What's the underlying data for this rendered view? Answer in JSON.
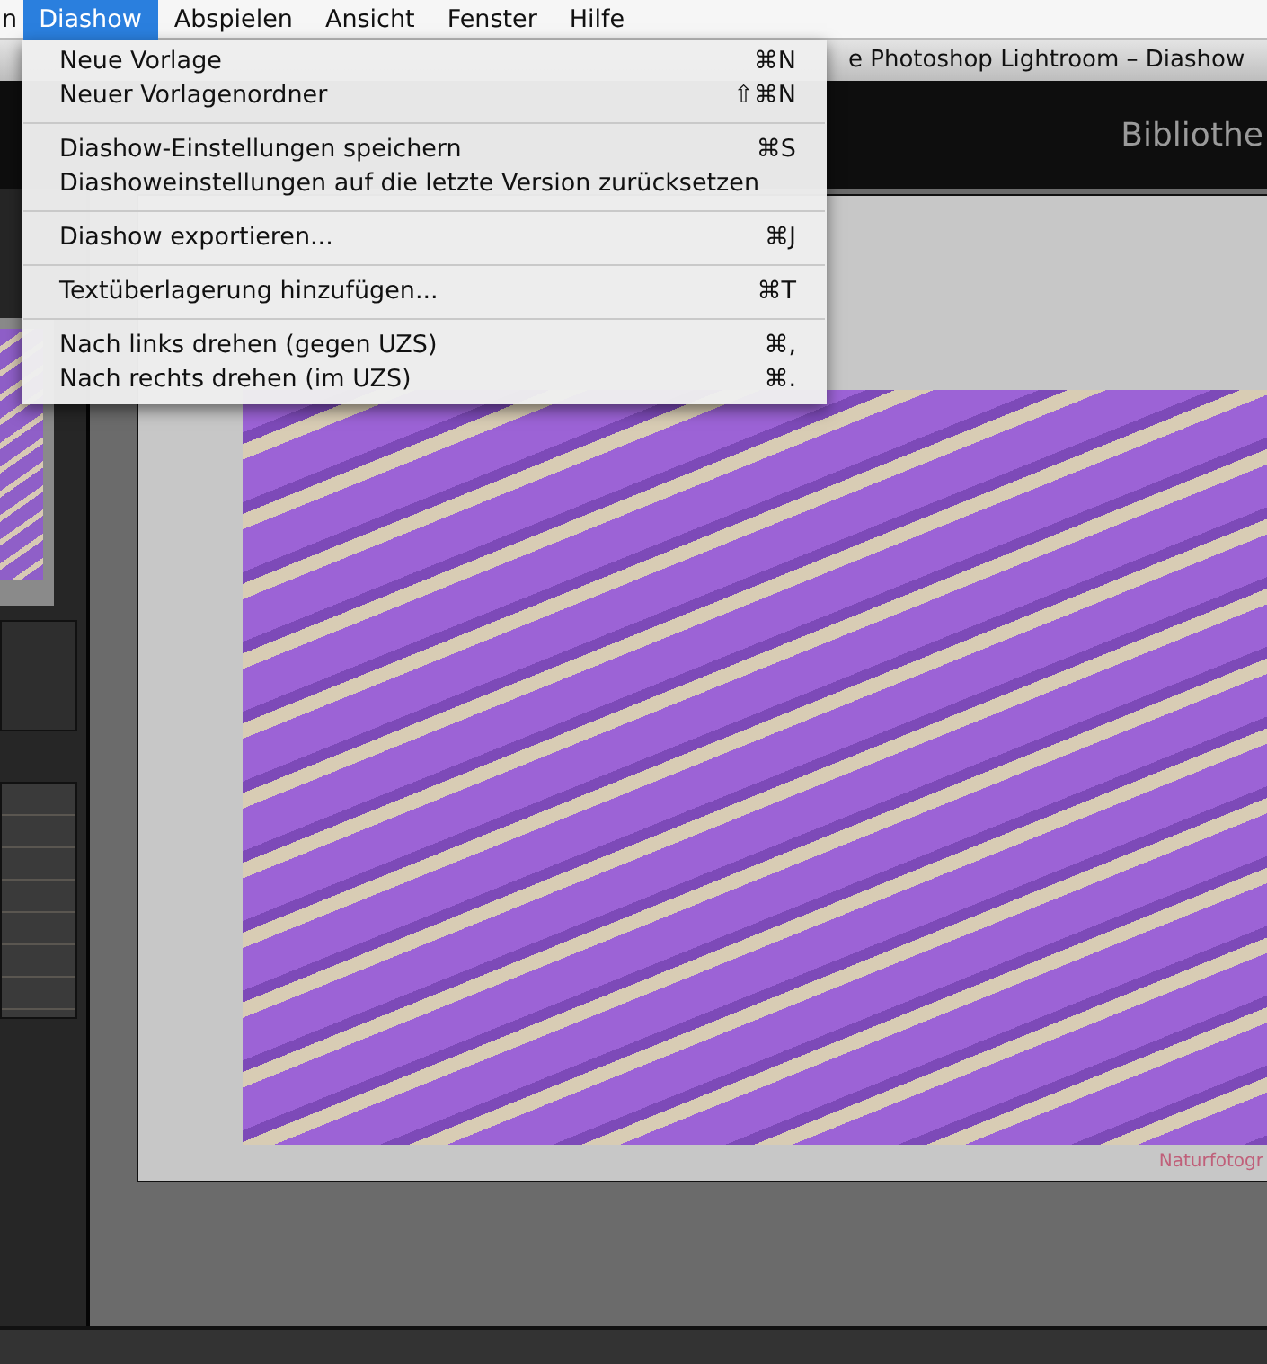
{
  "menu_bar": [
    {
      "label": "n",
      "selected": false
    },
    {
      "label": "Diashow",
      "selected": true
    },
    {
      "label": "Abspielen",
      "selected": false
    },
    {
      "label": "Ansicht",
      "selected": false
    },
    {
      "label": "Fenster",
      "selected": false
    },
    {
      "label": "Hilfe",
      "selected": false
    }
  ],
  "window": {
    "title": "e Photoshop Lightroom – Diashow"
  },
  "module_picker": {
    "label": "Bibliothe"
  },
  "dropdown": {
    "sections": [
      [
        {
          "label": "Neue Vorlage",
          "shortcut": "⌘N"
        },
        {
          "label": "Neuer Vorlagenordner",
          "shortcut": "⇧⌘N"
        }
      ],
      [
        {
          "label": "Diashow-Einstellungen speichern",
          "shortcut": "⌘S"
        },
        {
          "label": "Diashoweinstellungen auf die letzte Version zurücksetzen"
        }
      ],
      [
        {
          "label": "Diashow exportieren...",
          "shortcut": "⌘J"
        }
      ],
      [
        {
          "label": "Textüberlagerung hinzufügen...",
          "shortcut": "⌘T"
        }
      ],
      [
        {
          "label": "Nach links drehen (gegen UZS)",
          "shortcut": "⌘,"
        },
        {
          "label": "Nach rechts drehen (im UZS)",
          "shortcut": "⌘."
        }
      ]
    ]
  },
  "slide": {
    "caption": "Naturfotogr"
  }
}
